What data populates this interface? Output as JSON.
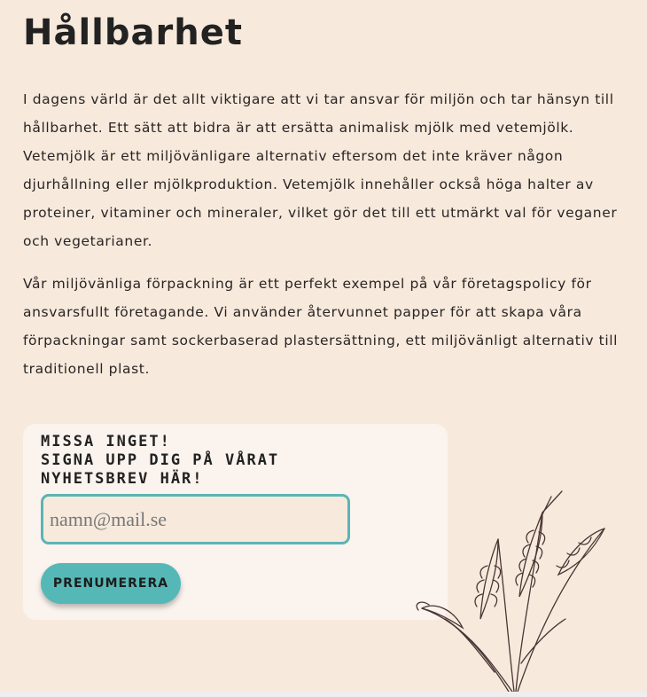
{
  "page": {
    "title": "Hållbarhet",
    "paragraphs": [
      "I dagens värld är det allt viktigare att vi tar ansvar för miljön och tar hänsyn till hållbarhet. Ett sätt att bidra är att ersätta animalisk mjölk med vetemjölk. Vetemjölk är ett miljövänligare alternativ eftersom det inte kräver någon djurhållning eller mjölkproduktion. Vetemjölk innehåller också höga halter av proteiner, vitaminer och mineraler, vilket gör det till ett utmärkt val för veganer och vegetarianer.",
      "Vår miljövänliga förpackning är ett perfekt exempel på vår företagspolicy för ansvarsfullt företagande. Vi använder återvunnet papper för att skapa våra förpackningar samt sockerbaserad plastersättning, ett miljövänligt alternativ till traditionell plast."
    ]
  },
  "signup": {
    "heading_line1": "MISSA INGET!",
    "heading_line2": "SIGNA UPP DIG PÅ VÅRAT",
    "heading_line3": "NYHETSBREV HÄR!",
    "email_placeholder": "namn@mail.se",
    "email_value": "",
    "button_label": "PRENUMERERA"
  },
  "decor": {
    "illustration": "wheat-illustration"
  },
  "colors": {
    "background": "#f7eadc",
    "card": "#faf3ee",
    "accent": "#56b8b6",
    "text": "#2a2424"
  }
}
